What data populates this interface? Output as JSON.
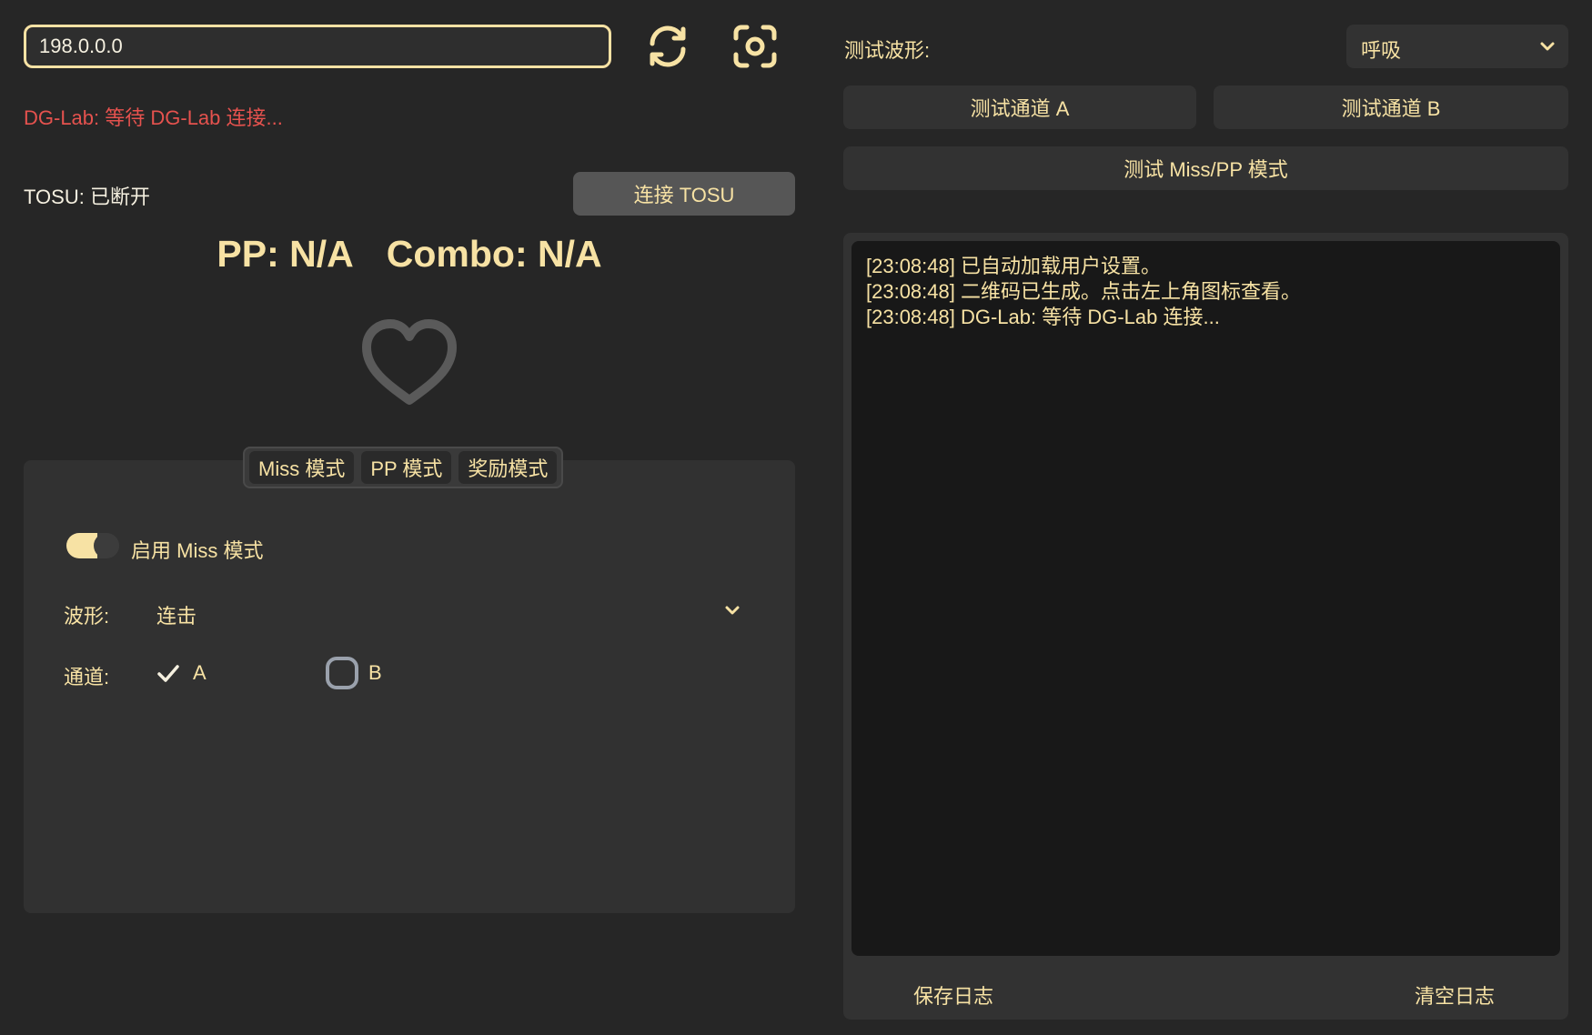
{
  "left": {
    "ip_value": "198.0.0.0",
    "dglab_status": "DG-Lab: 等待 DG-Lab 连接...",
    "tosu_status": "TOSU: 已断开",
    "connect_tosu_label": "连接 TOSU",
    "pp_text": "PP: N/A",
    "combo_text": "Combo: N/A",
    "tabs": [
      {
        "label": "Miss 模式"
      },
      {
        "label": "PP 模式"
      },
      {
        "label": "奖励模式"
      }
    ],
    "miss_mode": {
      "enable_label": "启用 Miss 模式",
      "enabled": true,
      "wave_label": "波形:",
      "wave_value": "连击",
      "channel_label": "通道:",
      "channel_a_label": "A",
      "channel_b_label": "B",
      "channel_a_checked": true,
      "channel_b_checked": false
    }
  },
  "right": {
    "test_wave_label": "测试波形:",
    "test_wave_value": "呼吸",
    "test_a_label": "测试通道 A",
    "test_b_label": "测试通道 B",
    "test_miss_label": "测试 Miss/PP 模式",
    "log_lines": [
      "[23:08:48] 已自动加载用户设置。",
      "[23:08:48] 二维码已生成。点击左上角图标查看。",
      "[23:08:48] DG-Lab: 等待 DG-Lab 连接..."
    ],
    "save_log_label": "保存日志",
    "clear_log_label": "清空日志"
  },
  "colors": {
    "accent": "#f7e2a4",
    "error": "#e5524e",
    "background": "#262626",
    "panel": "#313131",
    "log_bg": "#181818"
  },
  "icons": {
    "refresh": "refresh-icon",
    "scan": "scan-icon",
    "heart": "heart-icon",
    "chevron": "chevron-down-icon",
    "check": "check-icon"
  }
}
